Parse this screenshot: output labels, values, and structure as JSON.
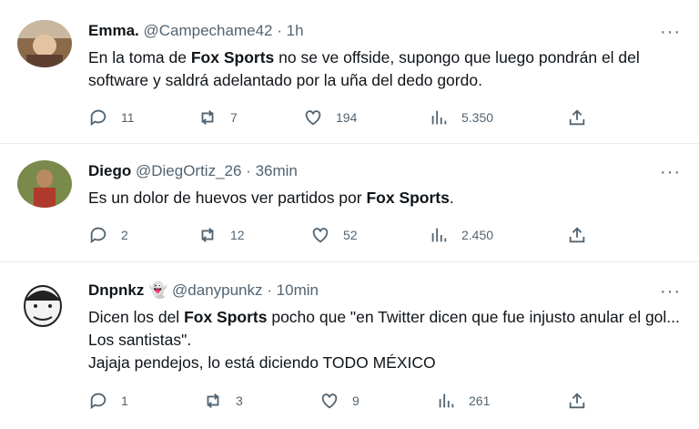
{
  "tweets": [
    {
      "name": "Emma.",
      "handle": "@Campechame42",
      "time": "1h",
      "text_parts": [
        "En la toma de ",
        "Fox Sports",
        " no se ve offside, supongo que luego pondrán el del software y saldrá adelantado por la uña del dedo gordo."
      ],
      "replies": "11",
      "retweets": "7",
      "likes": "194",
      "views": "5.350"
    },
    {
      "name": "Diego",
      "handle": "@DiegOrtiz_26",
      "time": "36min",
      "text_parts": [
        "Es un dolor de huevos ver partidos por ",
        "Fox Sports",
        "."
      ],
      "replies": "2",
      "retweets": "12",
      "likes": "52",
      "views": "2.450"
    },
    {
      "name": "Dnpnkz",
      "handle": "@danypunkz",
      "time": "10min",
      "text_parts": [
        "Dicen los del ",
        "Fox Sports",
        " pocho que \"en Twitter dicen que fue injusto anular el gol... Los santistas\"."
      ],
      "text_line2": "Jajaja pendejos, lo está diciendo TODO MÉXICO",
      "replies": "1",
      "retweets": "3",
      "likes": "9",
      "views": "261"
    }
  ],
  "ui": {
    "more_glyph": "···",
    "separator": "·"
  },
  "colors": {
    "text": "#0f1419",
    "secondary": "#536471",
    "border": "#e6ecf0"
  }
}
